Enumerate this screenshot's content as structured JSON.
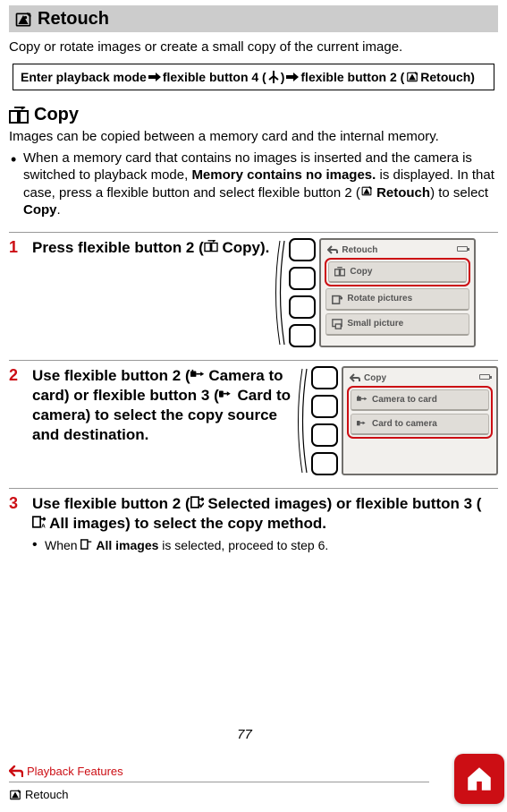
{
  "colors": {
    "accent": "#cc0e14",
    "gray": "#cccccc"
  },
  "icons": {
    "retouch": "retouch-icon",
    "copy_screens": "copy-screens-icon",
    "arrow_right": "arrow-right",
    "psi": "fork-icon",
    "back": "back-arrow",
    "home": "home-icon"
  },
  "h1": "Retouch",
  "intro": "Copy or rotate images or create a small copy of the current image.",
  "nav": {
    "enter": "Enter playback mode",
    "fb4": "flexible button 4 (",
    "fb4_close": ")",
    "fb2": "flexible button 2 (",
    "fb2_label": "Retouch)"
  },
  "h2": "Copy",
  "copy_intro": "Images can be copied between a memory card and the internal memory.",
  "bullet1_a": "When a memory card that contains no images is inserted and the camera is switched to playback mode, ",
  "bullet1_b": "Memory contains no images.",
  "bullet1_c": " is displayed. In that case, press a flexible button and select flexible button 2 (",
  "bullet1_d": "Retouch",
  "bullet1_e": ") to select ",
  "bullet1_f": "Copy",
  "bullet1_g": ".",
  "step1": {
    "num": "1",
    "body_a": "Press flexible button 2 (",
    "body_b": "Copy",
    "body_c": ").",
    "screen": {
      "title": "Retouch",
      "items": {
        "copy": "Copy",
        "rotate": "Rotate pictures",
        "small": "Small picture"
      }
    }
  },
  "step2": {
    "num": "2",
    "body_a": "Use flexible button 2 (",
    "body_b": "Camera to card",
    "body_c": ") or flexible button 3 (",
    "body_d": "Card to camera",
    "body_e": ") to select the copy source and destination.",
    "screen": {
      "title": "Copy",
      "items": {
        "cam_to_card": "Camera to card",
        "card_to_cam": "Card to camera"
      }
    }
  },
  "step3": {
    "num": "3",
    "body_a": "Use flexible button 2 (",
    "body_b": "Selected images",
    "body_c": ") or flexible button 3 (",
    "body_d": "All images",
    "body_e": ") to select the copy method.",
    "sub_a": "When ",
    "sub_b": "All images",
    "sub_c": " is selected, proceed to step 6."
  },
  "page_number": "77",
  "footer": {
    "playback": "Playback Features",
    "retouch": "Retouch"
  }
}
